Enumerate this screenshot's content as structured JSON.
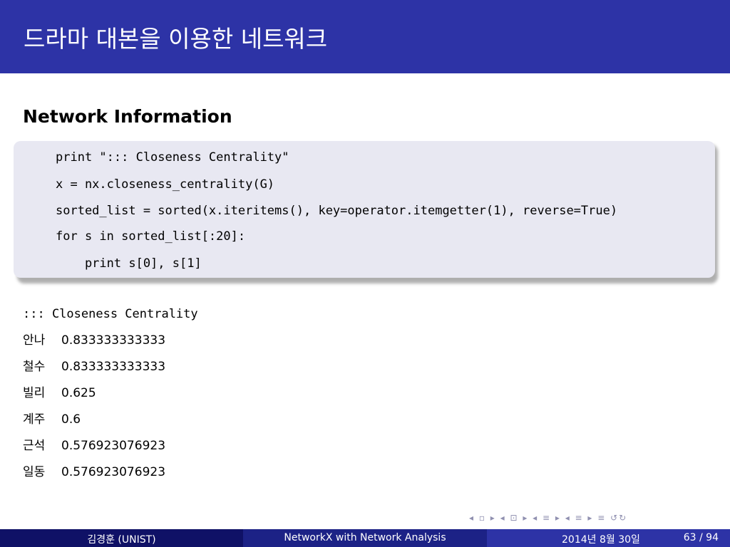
{
  "slide": {
    "title": "드라마 대본을 이용한 네트워크",
    "frame_title": "Network Information"
  },
  "code": {
    "lines": [
      "print \"::: Closeness Centrality\"",
      "x = nx.closeness_centrality(G)",
      "sorted_list = sorted(x.iteritems(), key=operator.itemgetter(1), reverse=True)",
      "for s in sorted_list[:20]:",
      "    print s[0], s[1]"
    ]
  },
  "output": {
    "header": "::: Closeness Centrality",
    "rows": [
      {
        "name": "안나",
        "value": "0.833333333333"
      },
      {
        "name": "철수",
        "value": "0.833333333333"
      },
      {
        "name": "빌리",
        "value": "0.625"
      },
      {
        "name": "계주",
        "value": "0.6"
      },
      {
        "name": "근석",
        "value": "0.576923076923"
      },
      {
        "name": "일동",
        "value": "0.576923076923"
      }
    ]
  },
  "nav": {
    "symbols": "◂ ▫ ▸ ◂ ⊡ ▸ ◂ ≡ ▸ ◂ ≡ ▸ ≡ ↺↻"
  },
  "footer": {
    "author": "김경훈 (UNIST)",
    "talk_title": "NetworkX with Network Analysis",
    "date": "2014년 8월 30일",
    "page": "63 / 94"
  },
  "colors": {
    "title_bar": "#2d33a6",
    "footer_dark": "#0f1166",
    "footer_mid": "#1c2286",
    "code_block_bg": "#e8e8f2"
  }
}
